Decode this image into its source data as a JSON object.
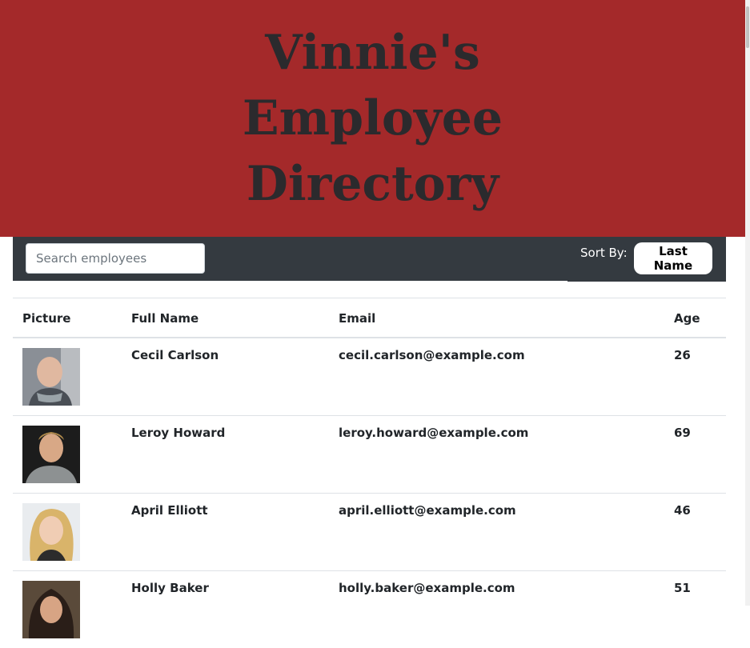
{
  "header": {
    "title": "Vinnie's Employee Directory"
  },
  "toolbar": {
    "search_placeholder": "Search employees",
    "sort_label": "Sort By:",
    "sort_button": "Last Name"
  },
  "table": {
    "columns": [
      "Picture",
      "Full Name",
      "Email",
      "Age"
    ],
    "rows": [
      {
        "name": "Cecil Carlson",
        "email": "cecil.carlson@example.com",
        "age": "26"
      },
      {
        "name": "Leroy Howard",
        "email": "leroy.howard@example.com",
        "age": "69"
      },
      {
        "name": "April Elliott",
        "email": "april.elliott@example.com",
        "age": "46"
      },
      {
        "name": "Holly Baker",
        "email": "holly.baker@example.com",
        "age": "51"
      }
    ]
  },
  "colors": {
    "hero_bg": "#a4292a",
    "toolbar_bg": "#343a40"
  }
}
